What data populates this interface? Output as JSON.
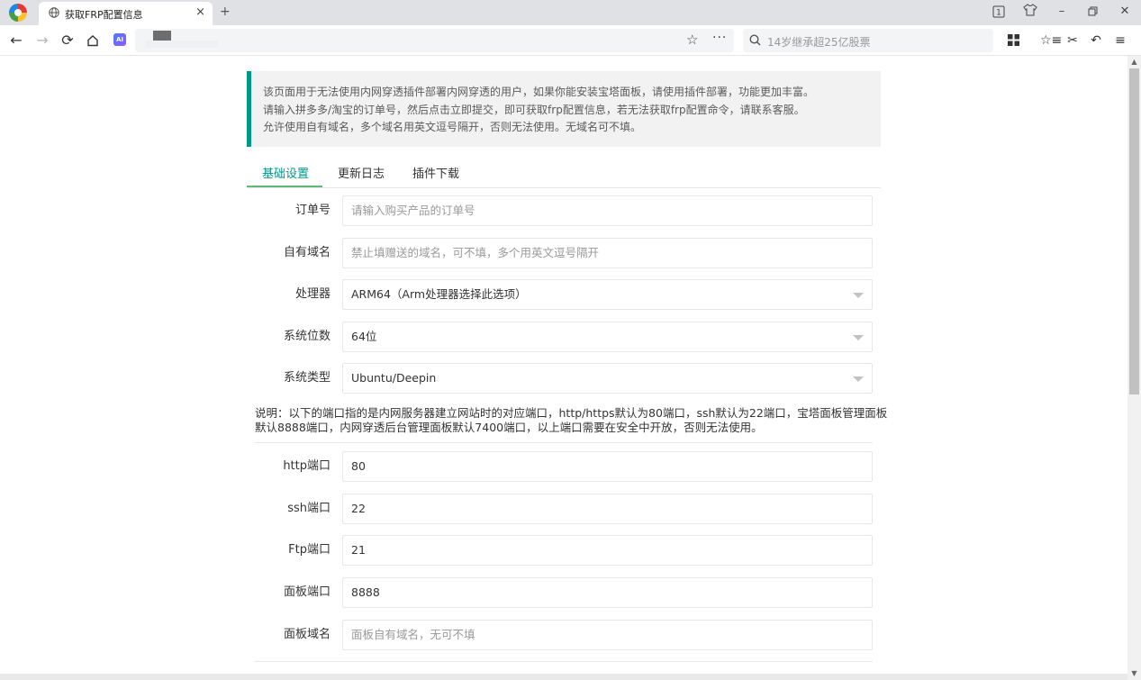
{
  "browser": {
    "tab_title": "获取FRP配置信息",
    "tab_close": "×",
    "new_tab": "+",
    "tab_count": "1",
    "search_placeholder": "14岁继承超25亿股票",
    "ai_label": "AI"
  },
  "notice": {
    "lines": [
      "该页面用于无法使用内网穿透插件部署内网穿透的用户，如果你能安装宝塔面板，请使用插件部署，功能更加丰富。",
      "请输入拼多多/淘宝的订单号，然后点击立即提交，即可获取frp配置信息，若无法获取frp配置命令，请联系客服。",
      "允许使用自有域名，多个域名用英文逗号隔开，否则无法使用。无域名可不填。"
    ],
    "accent_color": "#009688"
  },
  "tabs": [
    {
      "label": "基础设置",
      "active": true
    },
    {
      "label": "更新日志",
      "active": false
    },
    {
      "label": "插件下载",
      "active": false
    }
  ],
  "form": {
    "order": {
      "label": "订单号",
      "value": "",
      "placeholder": "请输入购买产品的订单号"
    },
    "domain": {
      "label": "自有域名",
      "value": "",
      "placeholder": "禁止填赠送的域名，可不填，多个用英文逗号隔开"
    },
    "cpu": {
      "label": "处理器",
      "value": "ARM64（Arm处理器选择此选项）"
    },
    "bits": {
      "label": "系统位数",
      "value": "64位"
    },
    "os": {
      "label": "系统类型",
      "value": "Ubuntu/Deepin"
    },
    "explain": [
      "说明：以下的端口指的是内网服务器建立网站时的对应端口，http/https默认为80端口，ssh默认为22端口，宝塔面板管理面板",
      "默认8888端口，内网穿透后台管理面板默认7400端口，以上端口需要在安全中开放，否则无法使用。"
    ],
    "http": {
      "label": "http端口",
      "value": "80"
    },
    "ssh": {
      "label": "ssh端口",
      "value": "22"
    },
    "ftp": {
      "label": "Ftp端口",
      "value": "21"
    },
    "panel_port": {
      "label": "面板端口",
      "value": "8888"
    },
    "panel_domain": {
      "label": "面板域名",
      "value": "",
      "placeholder": "面板自有域名，无可不填"
    }
  }
}
